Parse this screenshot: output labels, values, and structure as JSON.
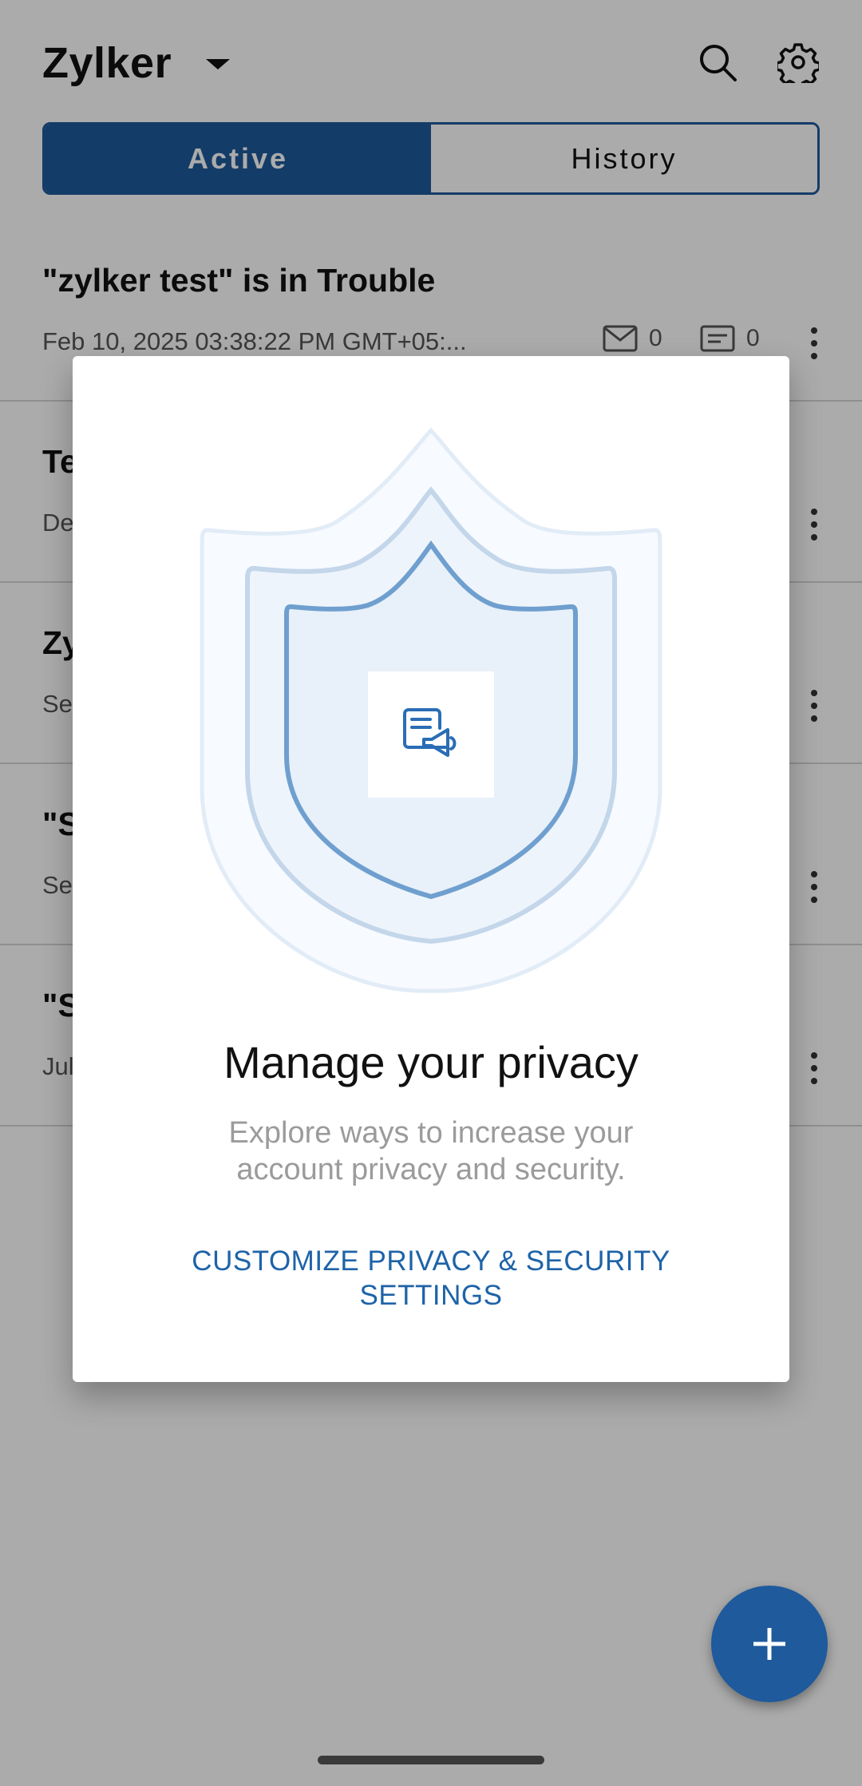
{
  "header": {
    "org_name": "Zylker",
    "search_icon": "search-icon",
    "settings_icon": "gear-icon"
  },
  "tabs": {
    "active_label": "Active",
    "history_label": "History"
  },
  "incidents": [
    {
      "title": "\"zylker test\" is in Trouble",
      "date": "Feb 10, 2025 03:38:22 PM GMT+05:...",
      "mail_count": "0",
      "note_count": "0"
    },
    {
      "title": "Te",
      "date": "De"
    },
    {
      "title": "Zy",
      "date": "Se"
    },
    {
      "title": "\"S",
      "date": "Se"
    },
    {
      "title": "\"S",
      "date": "Jul"
    }
  ],
  "dialog": {
    "illustration_icon": "document-megaphone-icon",
    "title": "Manage your privacy",
    "body": "Explore ways to increase your account privacy and security.",
    "cta": "CUSTOMIZE PRIVACY & SECURITY SETTINGS"
  },
  "fab": {
    "icon": "plus-icon"
  },
  "colors": {
    "brand": "#1e5a9c",
    "link": "#1e63a8",
    "shield_fill": "#e8f0f9",
    "shield_stroke_inner": "#6f9fcf",
    "shield_stroke_mid": "#c3d6ea",
    "shield_stroke_outer": "#e2ecf7"
  }
}
